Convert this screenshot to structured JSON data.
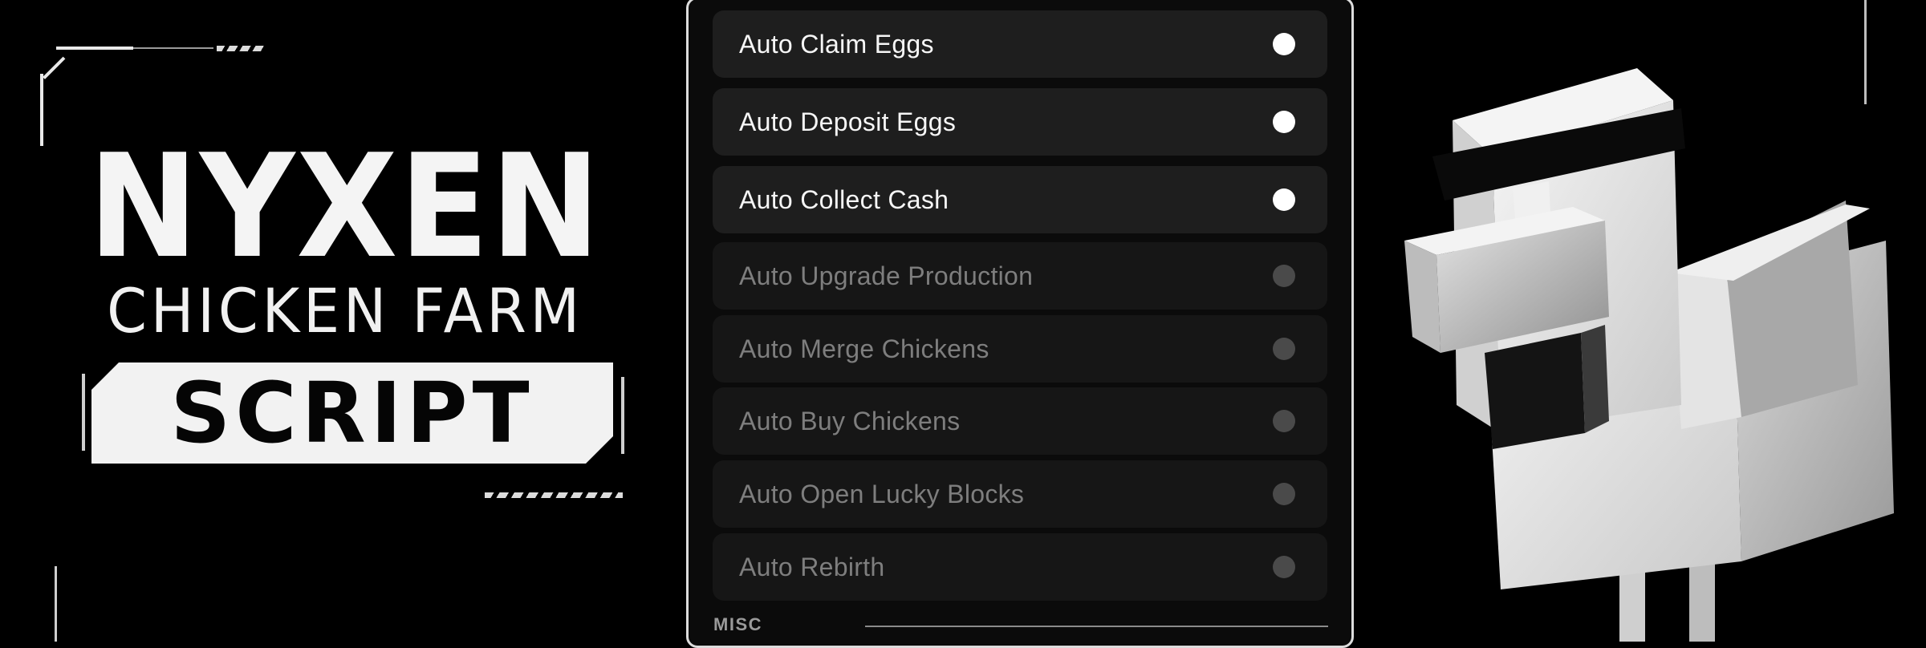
{
  "branding": {
    "title": "NYXEN",
    "subtitle": "CHICKEN FARM",
    "badge": "SCRIPT"
  },
  "menu": {
    "toggles": [
      {
        "label": "Auto Claim Eggs",
        "state": "on"
      },
      {
        "label": "Auto Deposit Eggs",
        "state": "on"
      },
      {
        "label": "Auto Collect Cash",
        "state": "on"
      },
      {
        "label": "Auto Upgrade Production",
        "state": "off"
      },
      {
        "label": "Auto Merge Chickens",
        "state": "off"
      },
      {
        "label": "Auto Buy Chickens",
        "state": "off"
      },
      {
        "label": "Auto Open Lucky Blocks",
        "state": "off"
      },
      {
        "label": "Auto Rebirth",
        "state": "off"
      }
    ],
    "section": "MISC"
  },
  "colors": {
    "background": "#000000",
    "panel": "#0b0b0b",
    "row_on": "#1e1e1e",
    "row_off": "#161616",
    "dot_on": "#ffffff",
    "dot_off": "#4a4a4a"
  },
  "icons": {
    "toggle": "toggle-dot-icon",
    "character": "blocky-chicken-icon"
  }
}
